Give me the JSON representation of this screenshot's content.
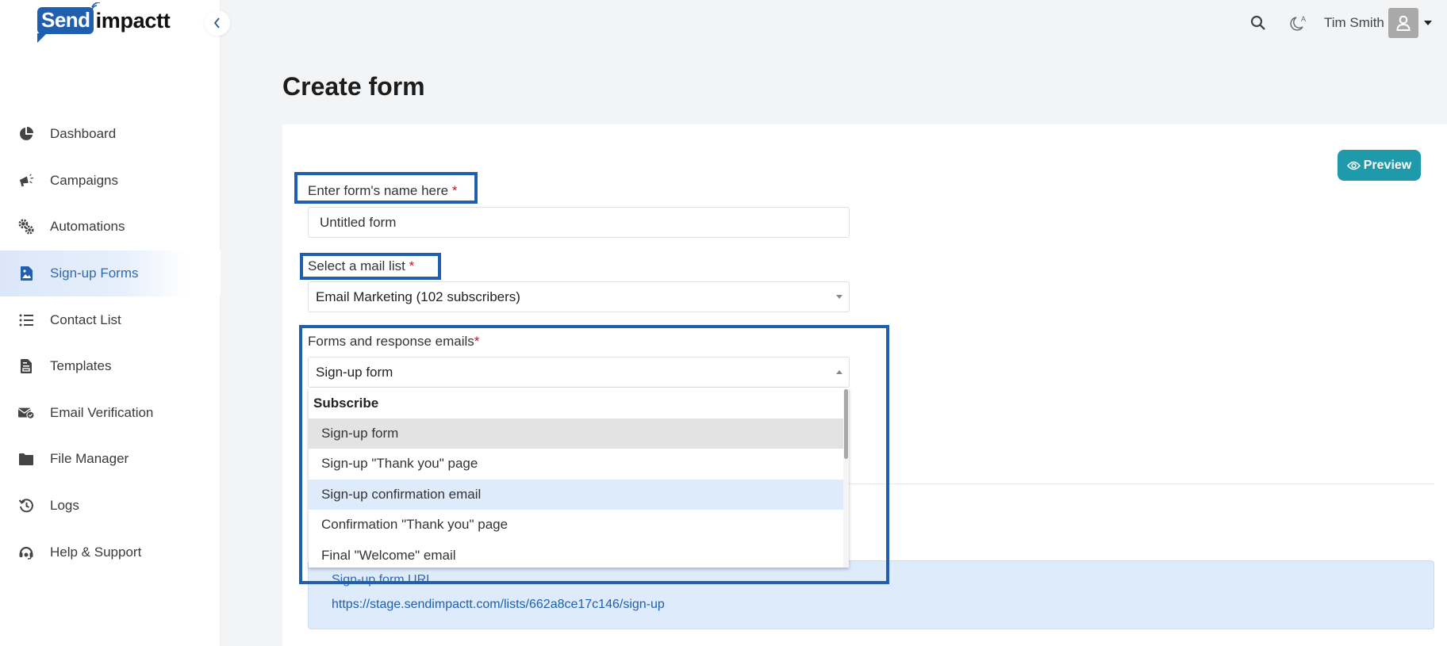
{
  "brand": {
    "logo_part1": "Send",
    "logo_part2": "impactt",
    "primary_color": "#1f5fae",
    "accent_color": "#1e9aab"
  },
  "sidebar": {
    "collapse_icon": "chevron-left-icon",
    "items": [
      {
        "label": "Dashboard",
        "icon": "pie-chart-icon",
        "active": false
      },
      {
        "label": "Campaigns",
        "icon": "megaphone-icon",
        "active": false
      },
      {
        "label": "Automations",
        "icon": "gears-icon",
        "active": false
      },
      {
        "label": "Sign-up Forms",
        "icon": "form-file-icon",
        "active": true
      },
      {
        "label": "Contact List",
        "icon": "list-icon",
        "active": false
      },
      {
        "label": "Templates",
        "icon": "template-file-icon",
        "active": false
      },
      {
        "label": "Email Verification",
        "icon": "envelope-check-icon",
        "active": false
      },
      {
        "label": "File Manager",
        "icon": "folder-icon",
        "active": false
      },
      {
        "label": "Logs",
        "icon": "history-icon",
        "active": false
      },
      {
        "label": "Help & Support",
        "icon": "headset-icon",
        "active": false
      }
    ]
  },
  "header": {
    "search_icon": "search-icon",
    "theme_icon": "theme-toggle-icon",
    "user_name": "Tim Smith",
    "avatar_icon": "user-icon",
    "menu_icon": "caret-down-icon"
  },
  "page": {
    "title": "Create form",
    "preview_label": "Preview"
  },
  "form": {
    "name_field": {
      "label": "Enter form's name here",
      "required_mark": "*",
      "value": "Untitled form"
    },
    "mail_list": {
      "label": "Select a mail list",
      "required_mark": "*",
      "selected": "Email Marketing (102 subscribers)"
    },
    "forms_emails": {
      "label": "Forms and response emails",
      "required_mark": "*",
      "selected": "Sign-up form",
      "expanded": true,
      "group_label": "Subscribe",
      "options": [
        {
          "label": "Sign-up form",
          "state": "selected"
        },
        {
          "label": "Sign-up \"Thank you\" page",
          "state": ""
        },
        {
          "label": "Sign-up confirmation email",
          "state": "hover"
        },
        {
          "label": "Confirmation \"Thank you\" page",
          "state": ""
        },
        {
          "label": "Final \"Welcome\" email",
          "state": ""
        }
      ]
    }
  },
  "url_panel": {
    "label": "Sign-up form URL",
    "url": "https://stage.sendimpactt.com/lists/662a8ce17c146/sign-up"
  }
}
